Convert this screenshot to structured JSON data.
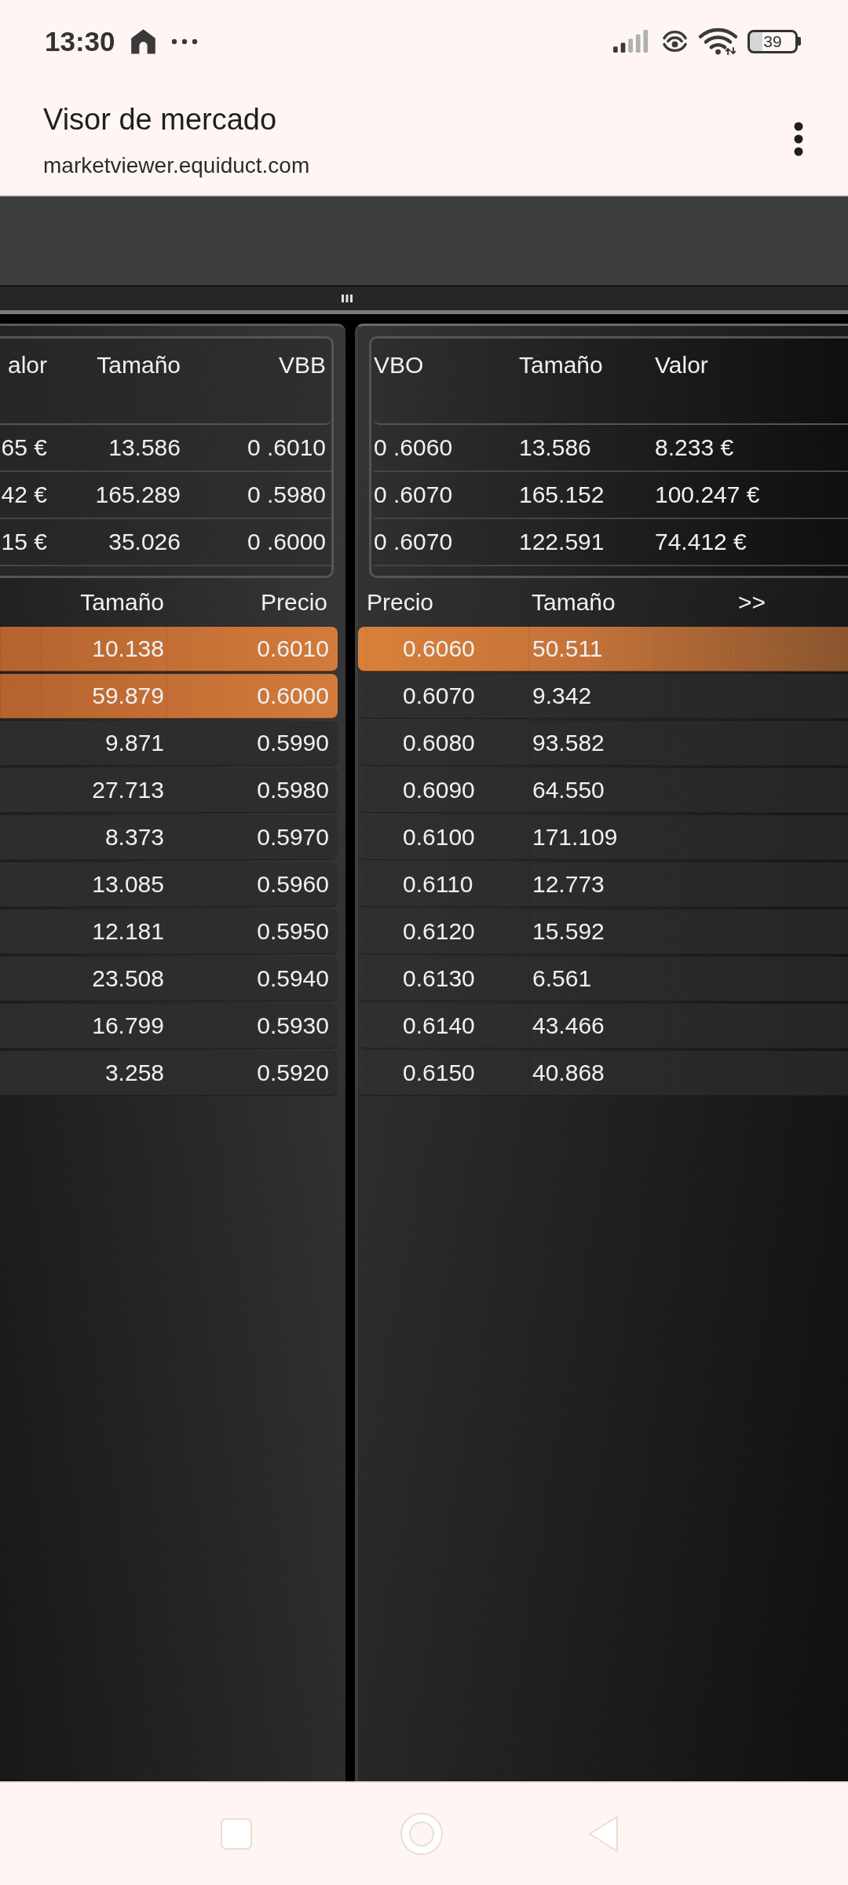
{
  "status_bar": {
    "time": "13:30",
    "battery": "39"
  },
  "browser_header": {
    "title": "Visor de mercado",
    "url": "marketviewer.equiduct.com"
  },
  "bid_side": {
    "summary": {
      "columns": [
        "alor",
        "Tamaño",
        "VBB"
      ],
      "rows": [
        [
          "65 €",
          "13.586",
          "0 .6010"
        ],
        [
          "42 €",
          "165.289",
          "0 .5980"
        ],
        [
          "15 €",
          "35.026",
          "0 .6000"
        ]
      ]
    },
    "depth": {
      "columns": [
        "Tamaño",
        "Precio"
      ],
      "rows": [
        {
          "size": "10.138",
          "price": "0.6010",
          "highlighted": true
        },
        {
          "size": "59.879",
          "price": "0.6000",
          "highlighted": true
        },
        {
          "size": "9.871",
          "price": "0.5990",
          "highlighted": false
        },
        {
          "size": "27.713",
          "price": "0.5980",
          "highlighted": false
        },
        {
          "size": "8.373",
          "price": "0.5970",
          "highlighted": false
        },
        {
          "size": "13.085",
          "price": "0.5960",
          "highlighted": false
        },
        {
          "size": "12.181",
          "price": "0.5950",
          "highlighted": false
        },
        {
          "size": "23.508",
          "price": "0.5940",
          "highlighted": false
        },
        {
          "size": "16.799",
          "price": "0.5930",
          "highlighted": false
        },
        {
          "size": "3.258",
          "price": "0.5920",
          "highlighted": false
        }
      ]
    }
  },
  "ask_side": {
    "summary": {
      "columns": [
        "VBO",
        "Tamaño",
        "Valor"
      ],
      "rows": [
        [
          "0 .6060",
          "13.586",
          "8.233 €"
        ],
        [
          "0 .6070",
          "165.152",
          "100.247 €"
        ],
        [
          "0 .6070",
          "122.591",
          "74.412 €"
        ]
      ]
    },
    "depth": {
      "columns": [
        "Precio",
        "Tamaño"
      ],
      "expand_label": ">>",
      "rows": [
        {
          "price": "0.6060",
          "size": "50.511",
          "highlighted": true
        },
        {
          "price": "0.6070",
          "size": "9.342",
          "highlighted": false
        },
        {
          "price": "0.6080",
          "size": "93.582",
          "highlighted": false
        },
        {
          "price": "0.6090",
          "size": "64.550",
          "highlighted": false
        },
        {
          "price": "0.6100",
          "size": "171.109",
          "highlighted": false
        },
        {
          "price": "0.6110",
          "size": "12.773",
          "highlighted": false
        },
        {
          "price": "0.6120",
          "size": "15.592",
          "highlighted": false
        },
        {
          "price": "0.6130",
          "size": "6.561",
          "highlighted": false
        },
        {
          "price": "0.6140",
          "size": "43.466",
          "highlighted": false
        },
        {
          "price": "0.6150",
          "size": "40.868",
          "highlighted": false
        }
      ]
    }
  }
}
